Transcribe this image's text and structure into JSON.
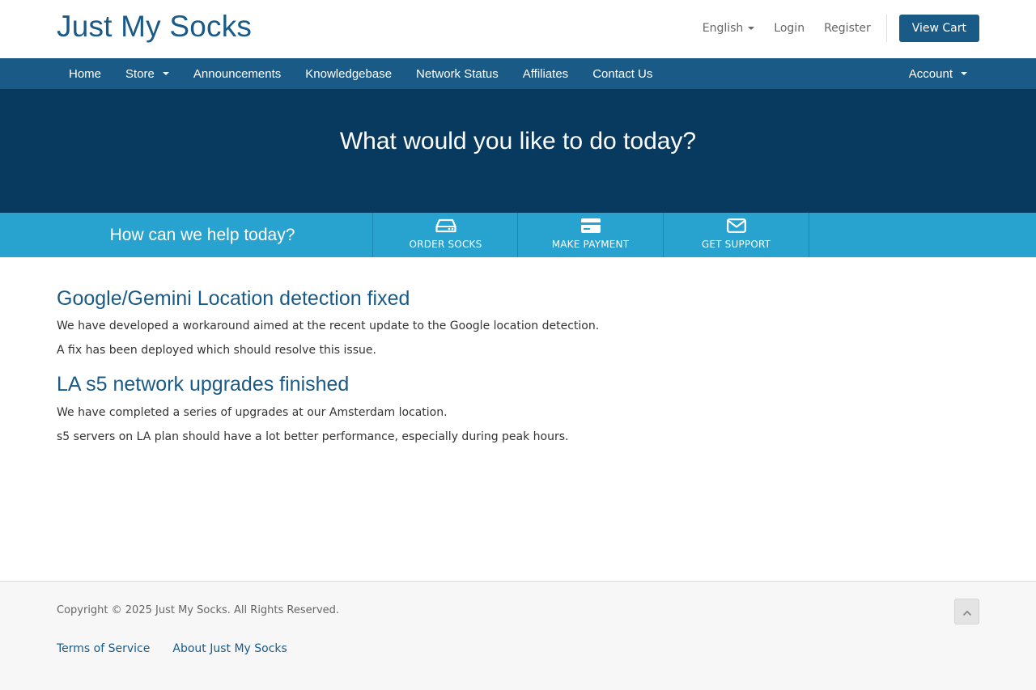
{
  "header": {
    "logo": "Just My Socks",
    "language": "English",
    "login": "Login",
    "register": "Register",
    "view_cart": "View Cart"
  },
  "nav": {
    "items": [
      {
        "label": "Home"
      },
      {
        "label": "Store"
      },
      {
        "label": "Announcements"
      },
      {
        "label": "Knowledgebase"
      },
      {
        "label": "Network Status"
      },
      {
        "label": "Affiliates"
      },
      {
        "label": "Contact Us"
      }
    ],
    "account": "Account"
  },
  "hero": {
    "title": "What would you like to do today?"
  },
  "helpbar": {
    "prompt": "How can we help today?",
    "tiles": [
      {
        "label": "ORDER SOCKS",
        "icon": "hdd-icon"
      },
      {
        "label": "MAKE PAYMENT",
        "icon": "credit-card-icon"
      },
      {
        "label": "GET SUPPORT",
        "icon": "envelope-icon"
      }
    ]
  },
  "announcements": [
    {
      "title": "Google/Gemini Location detection fixed",
      "lines": [
        "We have developed a workaround aimed at the recent update to the Google location detection.",
        "A fix has been deployed which should resolve this issue."
      ]
    },
    {
      "title": "LA s5 network upgrades finished",
      "lines": [
        "We have completed a series of upgrades at our Amsterdam location.",
        "s5 servers on LA plan should have a lot better performance, especially during peak hours."
      ]
    }
  ],
  "footer": {
    "copyright": "Copyright © 2025 Just My Socks. All Rights Reserved.",
    "links": [
      {
        "label": "Terms of Service"
      },
      {
        "label": "About Just My Socks"
      }
    ]
  },
  "colors": {
    "brand": "#1a5a86",
    "hero_bg": "#073a5e",
    "helpbar_bg": "#28a3cf",
    "footer_bg": "#f7f7f7"
  }
}
